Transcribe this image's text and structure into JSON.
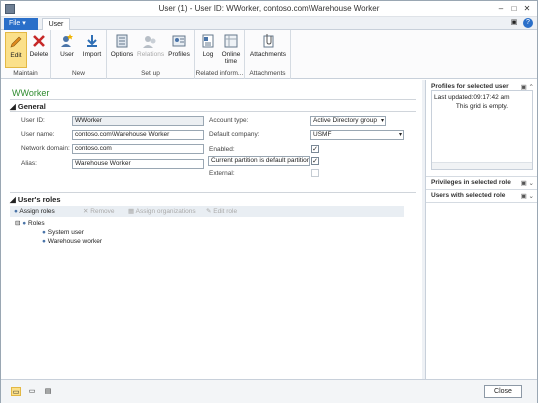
{
  "window": {
    "title": "User (1) - User ID: WWorker, contoso.com\\Warehouse Worker"
  },
  "tabs": {
    "file": "File",
    "user": "User"
  },
  "ribbon": {
    "edit": "Edit",
    "delete": "Delete",
    "maintain": "Maintain",
    "user": "User",
    "import": "Import",
    "new": "New",
    "options": "Options",
    "relations": "Relations",
    "profiles": "Profiles",
    "setup": "Set up",
    "log": "Log",
    "online_time_1": "Online",
    "online_time_2": "time",
    "related": "Related inform...",
    "attachments": "Attachments",
    "attachments_group": "Attachments"
  },
  "page": {
    "heading": "WWorker"
  },
  "general": {
    "title": "General",
    "user_id_label": "User ID:",
    "user_id": "WWorker",
    "user_name_label": "User name:",
    "user_name": "contoso.com\\Warehouse Worker",
    "network_domain_label": "Network domain:",
    "network_domain": "contoso.com",
    "alias_label": "Alias:",
    "alias": "Warehouse Worker",
    "account_type_label": "Account type:",
    "account_type": "Active Directory group",
    "default_company_label": "Default company:",
    "default_company": "USMF",
    "enabled_label": "Enabled:",
    "partition_label": "Current partition is default partition:",
    "external_label": "External:"
  },
  "roles": {
    "title": "User's roles",
    "assign_roles": "Assign roles",
    "remove": "Remove",
    "assign_orgs": "Assign organizations",
    "edit_role": "Edit role",
    "tree_root": "Roles",
    "role1": "System user",
    "role2": "Warehouse worker"
  },
  "right_panel": {
    "profiles_title": "Profiles for selected user",
    "last_updated": "Last updated:09:17:42 am",
    "empty": "This grid is empty.",
    "privileges_title": "Privileges in selected role",
    "users_title": "Users with selected role"
  },
  "statusbar": {
    "close": "Close"
  },
  "colors": {
    "accent": "#2a6fc9",
    "heading_green": "#2e8b2e",
    "edit_highlight": "#fbe08a"
  }
}
